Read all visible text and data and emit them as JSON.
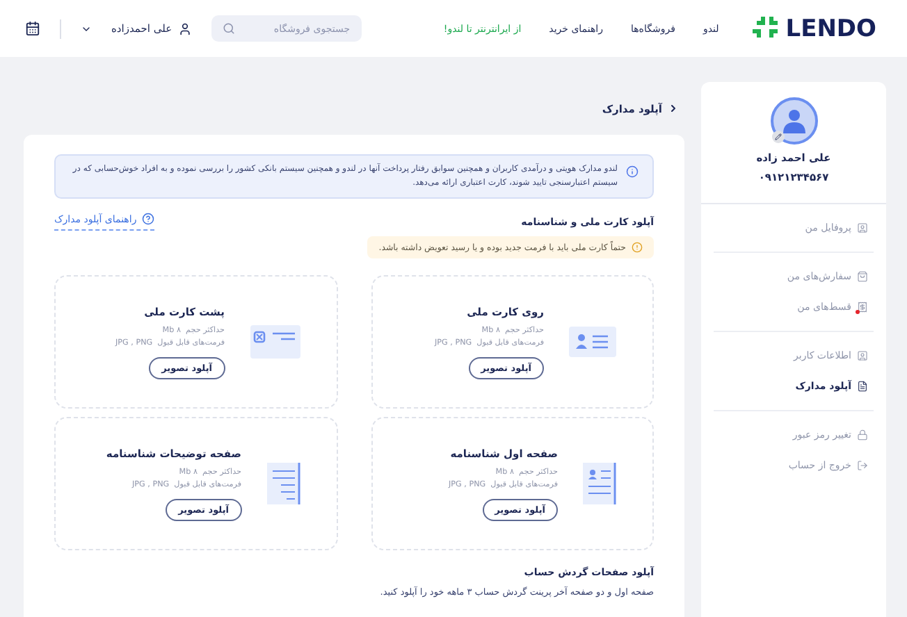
{
  "header": {
    "logo": "LENDO",
    "nav": [
      {
        "label": "لندو",
        "kind": "plain"
      },
      {
        "label": "فروشگاه‌ها",
        "kind": "plain"
      },
      {
        "label": "راهنمای خرید",
        "kind": "plain"
      },
      {
        "label": "از ایرانترنتر تا لندو!",
        "kind": "promo"
      }
    ],
    "search": {
      "placeholder": "جستجوی فروشگاه"
    },
    "user": "علی احمدزاده"
  },
  "breadcrumb": "آپلود مدارک",
  "notice": "لندو مدارک هویتی و درآمدی کاربران و همچنین سوابق رفتار پرداخت آنها در لندو و همچنین سیستم بانکی کشور را بررسی نموده و به افراد خوش‌حسابی که در سیستم اعتبارسنجی تایید شوند، کارت اعتباری ارائه می‌دهد.",
  "section": {
    "title": "آپلود کارت ملی و شناسنامه",
    "guide": "راهنمای آپلود مدارک",
    "warning": "حتماً کارت ملی باید با فرمت جدید بوده و یا رسید تعویض داشته باشد."
  },
  "cards": [
    {
      "kind": "id-front",
      "title": "روی کارت ملی",
      "size_label": "حداکثر حجم",
      "size": "۸ Mb",
      "format_label": "فرمت‌های قابل قبول",
      "formats": "JPG , PNG",
      "button": "آپلود تصویر"
    },
    {
      "kind": "id-back",
      "title": "پشت کارت ملی",
      "size_label": "حداکثر حجم",
      "size": "۸ Mb",
      "format_label": "فرمت‌های قابل قبول",
      "formats": "JPG , PNG",
      "button": "آپلود تصویر"
    },
    {
      "kind": "page-first",
      "title": "صفحه اول شناسنامه",
      "size_label": "حداکثر حجم",
      "size": "۸ Mb",
      "format_label": "فرمت‌های قابل قبول",
      "formats": "JPG , PNG",
      "button": "آپلود تصویر"
    },
    {
      "kind": "page-notes",
      "title": "صفحه توضیحات شناسنامه",
      "size_label": "حداکثر حجم",
      "size": "۸ Mb",
      "format_label": "فرمت‌های قابل قبول",
      "formats": "JPG , PNG",
      "button": "آپلود تصویر"
    }
  ],
  "statement": {
    "title": "آپلود صفحات گردش حساب",
    "text": "صفحه اول و دو صفحه آخر پرینت گردش حساب ۳ ماهه خود را آپلود کنید."
  },
  "profile": {
    "name": "علی احمد زاده",
    "phone": "۰۹۱۲۱۲۳۴۵۶۷"
  },
  "menu": [
    [
      {
        "label": "پروفایل من",
        "kind": "user",
        "selected": false,
        "alert": false
      }
    ],
    [
      {
        "label": "سفارش‌های من",
        "kind": "bag",
        "selected": false,
        "alert": false
      },
      {
        "label": "قسط‌های من",
        "kind": "bill",
        "selected": false,
        "alert": true
      }
    ],
    [
      {
        "label": "اطلاعات کاربر",
        "kind": "user",
        "selected": false,
        "alert": false
      },
      {
        "label": "آپلود مدارک",
        "kind": "doc",
        "selected": true,
        "alert": false
      }
    ],
    [
      {
        "label": "تغییر رمز عبور",
        "kind": "lock",
        "selected": false,
        "alert": false
      },
      {
        "label": "خروج از حساب",
        "kind": "exit",
        "selected": false,
        "alert": false
      }
    ]
  ]
}
